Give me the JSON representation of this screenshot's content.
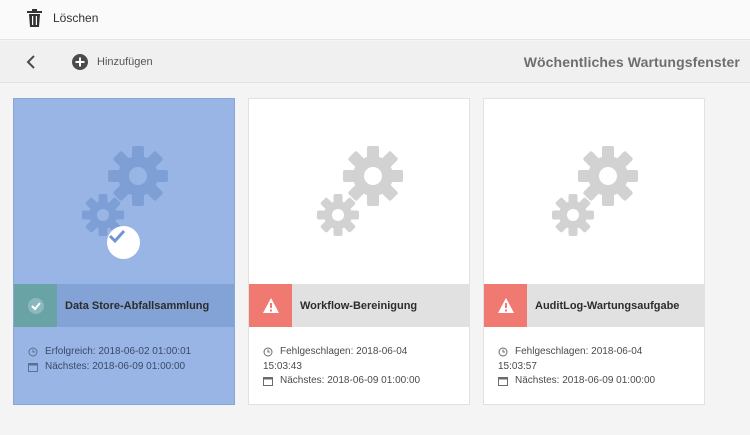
{
  "actionbar": {
    "delete_label": "Löschen"
  },
  "header": {
    "add_label": "Hinzufügen",
    "title": "Wöchentliches Wartungsfenster"
  },
  "colors": {
    "selected_card": "#98b5e5",
    "status_ok": "#6aa3a6",
    "status_error": "#f07a72",
    "gear_default": "#d2d2d2",
    "gear_selected": "#7e9fd6"
  },
  "cards": [
    {
      "title": "Data Store-Abfallsammlung",
      "status": "ok",
      "selected": true,
      "status_text": "Erfolgreich: 2018-06-02 01:00:01",
      "next_text": "Nächstes: 2018-06-09 01:00:00",
      "status_icon": "checkmark-icon"
    },
    {
      "title": "Workflow-Bereinigung",
      "status": "error",
      "selected": false,
      "status_text_line1": "Fehlgeschlagen: 2018-06-04",
      "status_text_line2": "15:03:43",
      "next_text": "Nächstes: 2018-06-09 01:00:00",
      "status_icon": "warning-icon"
    },
    {
      "title": "AuditLog-Wartungsaufgabe",
      "status": "error",
      "selected": false,
      "status_text_line1": "Fehlgeschlagen: 2018-06-04",
      "status_text_line2": "15:03:57",
      "next_text": "Nächstes: 2018-06-09 01:00:00",
      "status_icon": "warning-icon"
    }
  ]
}
